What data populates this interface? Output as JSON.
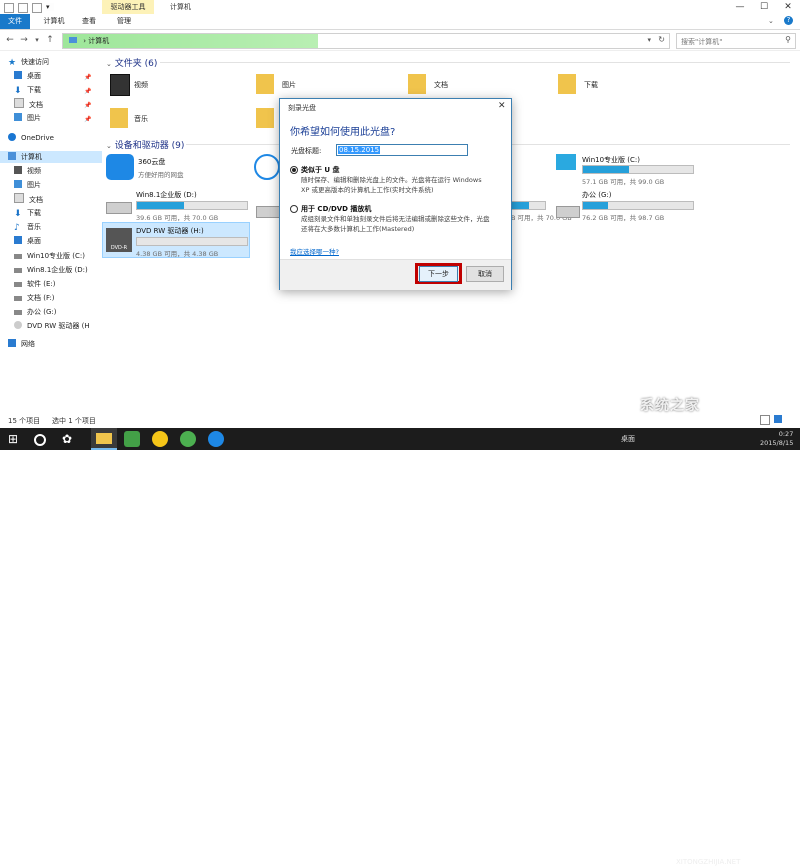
{
  "titlebar": {
    "context_tab": "驱动器工具",
    "title": "计算机",
    "buttons": {
      "minimize": "—",
      "maximize": "☐",
      "close": "✕"
    }
  },
  "ribbon": {
    "tabs": [
      "文件",
      "计算机",
      "查看",
      "管理"
    ],
    "accent": "#1979ca"
  },
  "address": {
    "path": "计算机",
    "search_placeholder": "搜索\"计算机\""
  },
  "sidebar": {
    "items": [
      {
        "label": "快速访问",
        "icon": "star-icon"
      },
      {
        "label": "桌面",
        "icon": "desktop-icon"
      },
      {
        "label": "下载",
        "icon": "download-icon"
      },
      {
        "label": "文档",
        "icon": "document-icon"
      },
      {
        "label": "图片",
        "icon": "picture-icon"
      },
      {
        "label": "OneDrive",
        "icon": "cloud-icon"
      },
      {
        "label": "计算机",
        "icon": "computer-icon"
      },
      {
        "label": "视频",
        "icon": "video-icon"
      },
      {
        "label": "图片",
        "icon": "picture-icon"
      },
      {
        "label": "文档",
        "icon": "document-icon"
      },
      {
        "label": "下载",
        "icon": "download-icon"
      },
      {
        "label": "音乐",
        "icon": "music-icon"
      },
      {
        "label": "桌面",
        "icon": "desktop-icon"
      },
      {
        "label": "Win10专业版 (C:)",
        "icon": "drive-icon"
      },
      {
        "label": "Win8.1企业版 (D:)",
        "icon": "drive-icon"
      },
      {
        "label": "软件 (E:)",
        "icon": "drive-icon"
      },
      {
        "label": "文档 (F:)",
        "icon": "drive-icon"
      },
      {
        "label": "办公 (G:)",
        "icon": "drive-icon"
      },
      {
        "label": "DVD RW 驱动器 (H",
        "icon": "dvd-icon"
      },
      {
        "label": "网络",
        "icon": "network-icon"
      }
    ]
  },
  "folders": {
    "title": "文件夹 (6)",
    "items": [
      "视频",
      "图片",
      "文档",
      "下载",
      "音乐"
    ]
  },
  "drives": {
    "title": "设备和驱动器 (9)",
    "cloud": {
      "name": "360云盘",
      "desc": "方便好用的网盘"
    },
    "items": [
      {
        "name": "Win8.1企业版 (D:)",
        "info": "39.6 GB 可用，共 70.0 GB",
        "used": 0.43
      },
      {
        "name": "DVD RW 驱动器 (H:)",
        "info": "4.38 GB 可用，共 4.38 GB",
        "used": 0.0
      },
      {
        "name": "Win10专业版 (C:)",
        "info": "57.1 GB 可用，共 99.0 GB",
        "used": 0.42
      },
      {
        "name": "办公 (G:)",
        "info": "76.2 GB 可用，共 98.7 GB",
        "used": 0.23
      }
    ],
    "partial_infos": [
      "GB 可用，共 70.0 GB",
      "GB"
    ]
  },
  "dialog": {
    "title": "刻录光盘",
    "close": "✕",
    "question": "你希望如何使用此光盘?",
    "disc_label": "光盘标题:",
    "disc_value": "08.15.2015",
    "option1_title": "类似于 U 盘",
    "option1_desc": "随时保存、编辑和删除光盘上的文件。光盘将在运行 Windows XP 或更高版本的计算机上工作(实时文件系统)",
    "option2_title": "用于 CD/DVD 播放机",
    "option2_desc": "成组刻录文件和单独刻录文件后将无法编辑或删除这些文件，光盘还将在大多数计算机上工作(Mastered)",
    "help_link": "我应选择哪一种?",
    "next": "下一步",
    "cancel": "取消"
  },
  "status": {
    "items_count": "15 个项目",
    "selected": "选中 1 个项目"
  },
  "taskbar": {
    "desktop_label": "桌面",
    "time": "2015/8/15",
    "clock": "0:27",
    "watermark": "系统之家",
    "watermark_url": "XITONGZHIJIA.NET"
  }
}
